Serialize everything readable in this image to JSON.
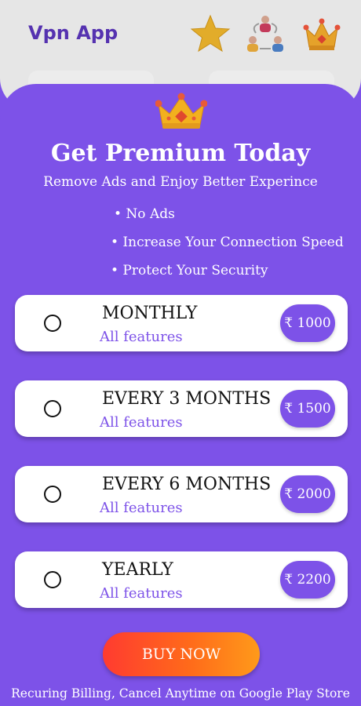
{
  "background_app": {
    "title": "Vpn App",
    "icons": [
      "star-icon",
      "people-exchange-icon",
      "crown-icon"
    ]
  },
  "premium": {
    "title": "Get Premium Today",
    "subtitle": "Remove Ads and Enjoy Better Experince",
    "benefits": [
      "• No Ads",
      "• Increase Your Connection Speed",
      "• Protect Your Security"
    ],
    "plans": [
      {
        "name": "MONTHLY",
        "subtitle": "All features",
        "price": "₹ 1000",
        "selected": false
      },
      {
        "name": "EVERY 3 MONTHS",
        "subtitle": "All features",
        "price": "₹ 1500",
        "selected": false
      },
      {
        "name": "EVERY 6 MONTHS",
        "subtitle": "All features",
        "price": "₹ 2000",
        "selected": false
      },
      {
        "name": "YEARLY",
        "subtitle": "All features",
        "price": "₹ 2200",
        "selected": false
      }
    ],
    "buy_label": "BUY NOW",
    "footer": "Recuring Billing, Cancel Anytime on Google Play Store"
  },
  "colors": {
    "primary": "#7d52e8",
    "buy_gradient_start": "#ff3b30",
    "buy_gradient_end": "#ff9a1a"
  }
}
